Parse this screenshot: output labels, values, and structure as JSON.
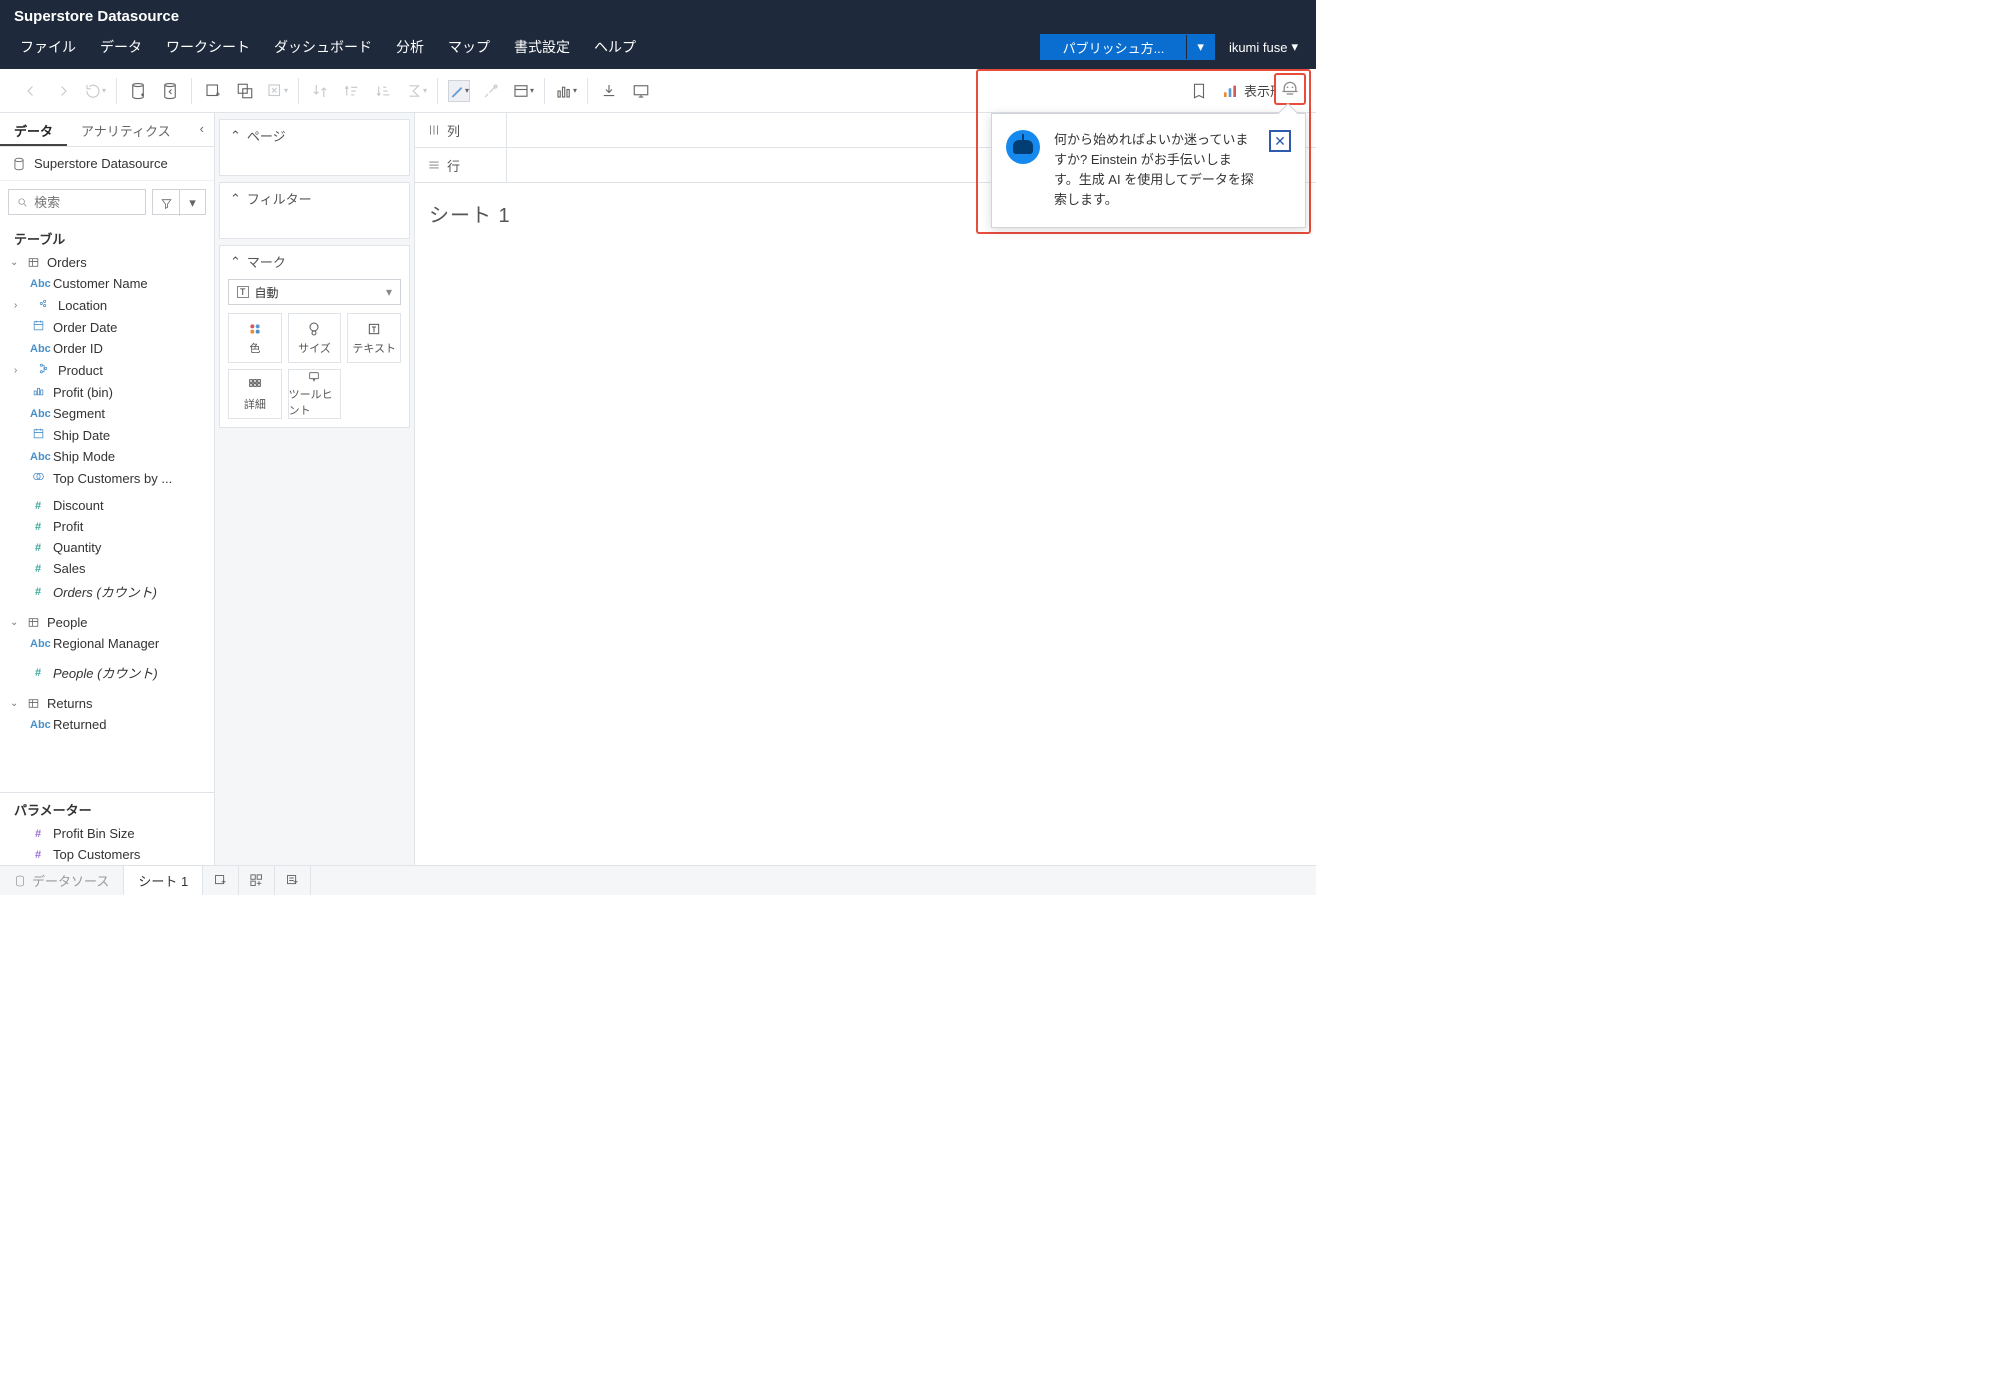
{
  "header": {
    "title": "Superstore Datasource",
    "menu": [
      "ファイル",
      "データ",
      "ワークシート",
      "ダッシュボード",
      "分析",
      "マップ",
      "書式設定",
      "ヘルプ"
    ],
    "publish_label": "パブリッシュ方...",
    "user": "ikumi fuse"
  },
  "toolbar": {
    "show_me": "表示形式"
  },
  "left": {
    "tabs": {
      "data": "データ",
      "analytics": "アナリティクス"
    },
    "datasource": "Superstore Datasource",
    "search_placeholder": "検索",
    "section_tables": "テーブル",
    "tables": [
      {
        "name": "Orders",
        "fields_dim": [
          {
            "type": "Abc",
            "name": "Customer Name"
          },
          {
            "type": "geo",
            "name": "Location",
            "expand": true
          },
          {
            "type": "date",
            "name": "Order Date"
          },
          {
            "type": "Abc",
            "name": "Order ID"
          },
          {
            "type": "hier",
            "name": "Product",
            "expand": true
          },
          {
            "type": "bin",
            "name": "Profit (bin)"
          },
          {
            "type": "Abc",
            "name": "Segment"
          },
          {
            "type": "date",
            "name": "Ship Date"
          },
          {
            "type": "Abc",
            "name": "Ship Mode"
          },
          {
            "type": "set",
            "name": "Top Customers by ..."
          }
        ],
        "fields_meas": [
          {
            "type": "#",
            "name": "Discount"
          },
          {
            "type": "#",
            "name": "Profit"
          },
          {
            "type": "#",
            "name": "Quantity"
          },
          {
            "type": "#",
            "name": "Sales"
          },
          {
            "type": "#",
            "name": "Orders (カウント)",
            "italic": true
          }
        ]
      },
      {
        "name": "People",
        "fields_dim": [
          {
            "type": "Abc",
            "name": "Regional Manager"
          }
        ],
        "fields_meas": [
          {
            "type": "#",
            "name": "People (カウント)",
            "italic": true
          }
        ]
      },
      {
        "name": "Returns",
        "fields_dim": [
          {
            "type": "Abc",
            "name": "Returned"
          }
        ]
      }
    ],
    "section_params": "パラメーター",
    "params": [
      {
        "type": "#",
        "name": "Profit Bin Size"
      },
      {
        "type": "#",
        "name": "Top Customers"
      }
    ]
  },
  "cards": {
    "pages": "ページ",
    "filters": "フィルター",
    "marks": "マーク",
    "mark_type": "自動",
    "cells": [
      "色",
      "サイズ",
      "テキスト",
      "詳細",
      "ツールヒント"
    ]
  },
  "shelves": {
    "columns": "列",
    "rows": "行"
  },
  "sheet_title": "シート 1",
  "popover": {
    "text": "何から始めればよいか迷っていますか? Einstein がお手伝いします。生成 AI を使用してデータを探索します。"
  },
  "bottom": {
    "datasource": "データソース",
    "sheet": "シート 1"
  }
}
